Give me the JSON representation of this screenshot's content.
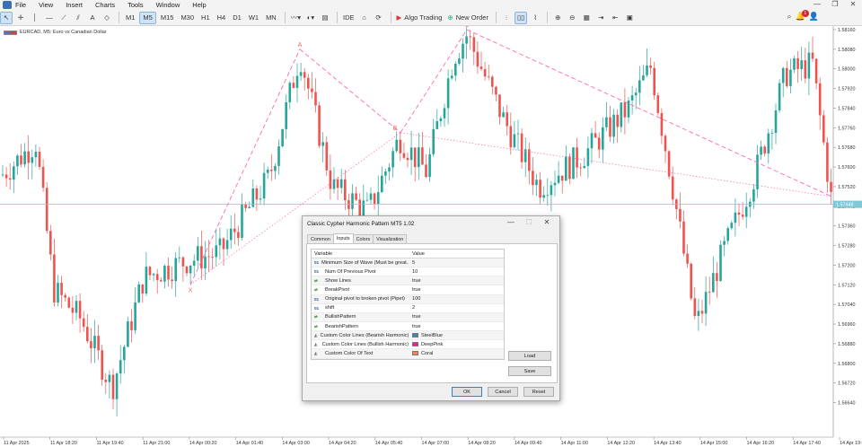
{
  "menu": {
    "items": [
      "File",
      "View",
      "Insert",
      "Charts",
      "Tools",
      "Window",
      "Help"
    ]
  },
  "toolbar": {
    "timeframes": [
      "M1",
      "M5",
      "M15",
      "M30",
      "H1",
      "H4",
      "D1",
      "W1",
      "MN"
    ],
    "active_timeframe": "M5",
    "ide_label": "IDE",
    "algo_trading_label": "Algo Trading",
    "new_order_label": "New Order",
    "notification_count": "1",
    "icons": [
      "cursor-icon",
      "crosshair-icon",
      "horizontal-line-icon",
      "trendline-icon",
      "vertical-line-icon",
      "channel-icon",
      "text-icon",
      "shapes-icon",
      "indicator-chart-icon",
      "color-icon",
      "template-icon",
      "ide-icon",
      "market-icon",
      "strategy-tester-icon",
      "algo-trading-icon",
      "new-order-icon",
      "bar-chart-icon",
      "candles-icon",
      "zoom-in-icon",
      "zoom-out-icon",
      "grid-icon",
      "autoscroll-icon",
      "screenshot-icon"
    ]
  },
  "symbol": {
    "label": "EURCAD, M5:  Euro vs Canadian Dollar"
  },
  "chart_data": {
    "type": "candlestick",
    "price_axis": [
      "1.58160",
      "1.58080",
      "1.58000",
      "1.57920",
      "1.57840",
      "1.57760",
      "1.57680",
      "1.57600",
      "1.57520",
      "1.57440",
      "1.57360",
      "1.57280",
      "1.57200",
      "1.57120",
      "1.57040",
      "1.56960",
      "1.56880",
      "1.56800",
      "1.56720",
      "1.56640"
    ],
    "current_price": "1.57448",
    "time_axis": [
      "11 Apr 2025",
      "11 Apr 18:20",
      "11 Apr 19:40",
      "11 Apr 21:00",
      "14 Apr 00:20",
      "14 Apr 01:40",
      "14 Apr 03:00",
      "14 Apr 04:20",
      "14 Apr 05:40",
      "14 Apr 07:00",
      "14 Apr 08:20",
      "14 Apr 09:40",
      "14 Apr 11:00",
      "14 Apr 12:20",
      "14 Apr 13:40",
      "14 Apr 15:00",
      "14 Apr 16:20",
      "14 Apr 17:40",
      "14 Apr 19:00"
    ],
    "pattern_points": [
      "X",
      "A",
      "B",
      "C"
    ],
    "up_color": "#26a69a",
    "down_color": "#ef5350",
    "pattern_color": "#ff69b4"
  },
  "dialog": {
    "title": "Classic Cypher Harmonic Pattern MT5 1.02",
    "tabs": [
      "Common",
      "Inputs",
      "Colors",
      "Visualization"
    ],
    "selected_tab": "Inputs",
    "columns": {
      "variable": "Variable",
      "value": "Value"
    },
    "params": [
      {
        "type": "01",
        "name": "Minimum Size of Wave (Must be great...",
        "value": "5"
      },
      {
        "type": "01",
        "name": "Num Of Previous Pivot",
        "value": "10"
      },
      {
        "type": "bool",
        "name": "Show Lines",
        "value": "true"
      },
      {
        "type": "bool",
        "name": "BreakPivot",
        "value": "true"
      },
      {
        "type": "01",
        "name": "Original pivot to broken pivot (Pipet)",
        "value": "100"
      },
      {
        "type": "01",
        "name": "shift",
        "value": "2"
      },
      {
        "type": "bool",
        "name": "BullishPattern",
        "value": "true"
      },
      {
        "type": "bool",
        "name": "BearishPattern",
        "value": "true"
      },
      {
        "type": "color",
        "name": "Custom Color Lines (Bearish Harmonic)",
        "value": "SteelBlue",
        "swatch": "#4682b4"
      },
      {
        "type": "color",
        "name": "Custom Color Lines (Bullish Harmonic)",
        "value": "DeepPink",
        "swatch": "#ff1493"
      },
      {
        "type": "color",
        "name": "Custom Color Of Text",
        "value": "Coral",
        "swatch": "#ff7f50"
      }
    ],
    "load_label": "Load",
    "save_label": "Save",
    "ok_label": "OK",
    "cancel_label": "Cancel",
    "reset_label": "Reset"
  }
}
